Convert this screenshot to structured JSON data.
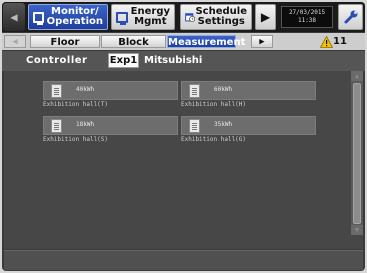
{
  "nav": {
    "monitor": "Monitor/\nOperation",
    "energy": "Energy\nMgmt",
    "schedule": "Schedule\nSettings",
    "date": "27/03/2015",
    "time": "11:38"
  },
  "tabs": {
    "floor": "Floor",
    "block": "Block",
    "measurement": "Measurement",
    "alarm_count": "11"
  },
  "controller": {
    "label": "Controller",
    "selected": "Exp1",
    "name": "Mitsubishi"
  },
  "cards": [
    {
      "value": "40kWh",
      "name": "Exhibition hall(T)"
    },
    {
      "value": "60kWh",
      "name": "Exhibition hall(H)"
    },
    {
      "value": "18kWh",
      "name": "Exhibition hall(S)"
    },
    {
      "value": "35kWh",
      "name": "Exhibition hall(G)"
    }
  ],
  "colors": {
    "accent": "#2a4fb3",
    "warning": "#f2c200"
  }
}
